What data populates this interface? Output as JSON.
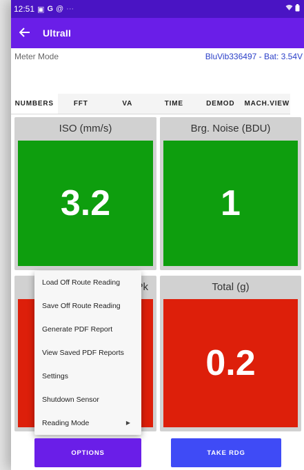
{
  "status_bar": {
    "time": "12:51",
    "left_icons": [
      "image-icon",
      "google-icon",
      "at-icon",
      "more-icon"
    ],
    "right_icons": [
      "wifi-icon",
      "battery-icon"
    ]
  },
  "app_bar": {
    "title": "UltraII"
  },
  "info": {
    "mode": "Meter Mode",
    "device": "BluVib336497 - Bat: 3.54V"
  },
  "tabs": [
    {
      "label": "NUMBERS",
      "active": true
    },
    {
      "label": "FFT",
      "active": false
    },
    {
      "label": "VA",
      "active": false
    },
    {
      "label": "TIME",
      "active": false
    },
    {
      "label": "DEMOD",
      "active": false
    },
    {
      "label": "MACH.VIEW",
      "active": false
    }
  ],
  "tiles": [
    {
      "label": "ISO (mm/s)",
      "value": "3.2",
      "color": "#0e9e0e"
    },
    {
      "label": "Brg. Noise (BDU)",
      "value": "1",
      "color": "#0e9e0e"
    },
    {
      "label": "Pk",
      "value": "",
      "color": "#dd1f0a"
    },
    {
      "label": "Total (g)",
      "value": "0.2",
      "color": "#dd1f0a"
    }
  ],
  "menu": {
    "items": [
      {
        "label": "Load Off Route Reading"
      },
      {
        "label": "Save Off Route Reading"
      },
      {
        "label": "Generate PDF Report"
      },
      {
        "label": "View Saved PDF Reports"
      },
      {
        "label": "Settings"
      },
      {
        "label": "Shutdown Sensor"
      },
      {
        "label": "Reading Mode",
        "submenu": true
      }
    ]
  },
  "buttons": {
    "options": "OPTIONS",
    "take_reading": "TAKE RDG"
  },
  "colors": {
    "status_bar": "#4a14c4",
    "app_bar": "#6a1ee8",
    "take_button": "#3f4bf6"
  }
}
